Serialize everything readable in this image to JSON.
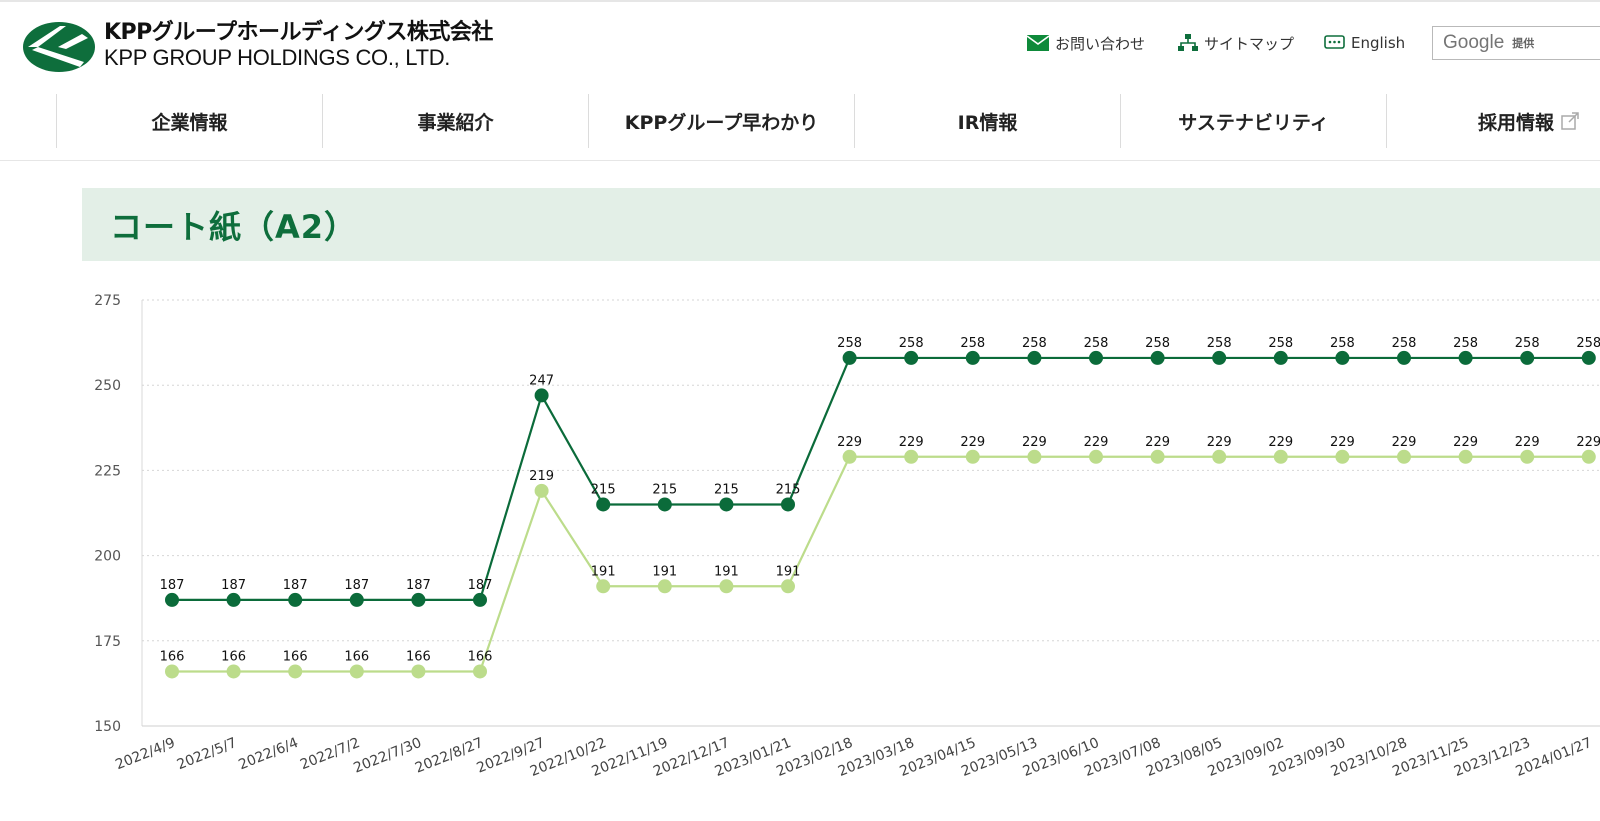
{
  "header": {
    "logo_jp": "KPPグループホールディングス株式会社",
    "logo_en": "KPP GROUP HOLDINGS CO., LTD.",
    "util_links": [
      {
        "label": "お問い合わせ",
        "icon": "mail-icon"
      },
      {
        "label": "サイトマップ",
        "icon": "sitemap-icon"
      },
      {
        "label": "English",
        "icon": "language-icon"
      }
    ],
    "search": {
      "brand": "Google",
      "suffix": "提供"
    }
  },
  "nav": {
    "items": [
      "企業情報",
      "事業紹介",
      "KPPグループ早わかり",
      "IR情報",
      "サステナビリティ",
      "採用情報"
    ]
  },
  "page": {
    "title": "コート紙（A2）"
  },
  "colors": {
    "brand_green": "#0e6e3c",
    "series_dark": "#0b6b3a",
    "series_light": "#bcdc8b",
    "title_band": "#e3efe7"
  },
  "chart_data": {
    "type": "line",
    "title": "",
    "xlabel": "",
    "ylabel": "",
    "ylim": [
      150,
      275
    ],
    "yticks": [
      150,
      175,
      200,
      225,
      250,
      275
    ],
    "grid": true,
    "categories": [
      "2022/4/9",
      "2022/5/7",
      "2022/6/4",
      "2022/7/2",
      "2022/7/30",
      "2022/8/27",
      "2022/9/27",
      "2022/10/22",
      "2022/11/19",
      "2022/12/17",
      "2023/01/21",
      "2023/02/18",
      "2023/03/18",
      "2023/04/15",
      "2023/05/13",
      "2023/06/10",
      "2023/07/08",
      "2023/08/05",
      "2023/09/02",
      "2023/09/30",
      "2023/10/28",
      "2023/11/25",
      "2023/12/23",
      "2024/01/27"
    ],
    "series": [
      {
        "color": "#0b6b3a",
        "values": [
          187,
          187,
          187,
          187,
          187,
          187,
          247,
          215,
          215,
          215,
          215,
          258,
          258,
          258,
          258,
          258,
          258,
          258,
          258,
          258,
          258,
          258,
          258,
          258
        ]
      },
      {
        "color": "#bcdc8b",
        "values": [
          166,
          166,
          166,
          166,
          166,
          166,
          219,
          191,
          191,
          191,
          191,
          229,
          229,
          229,
          229,
          229,
          229,
          229,
          229,
          229,
          229,
          229,
          229,
          229
        ]
      }
    ]
  }
}
